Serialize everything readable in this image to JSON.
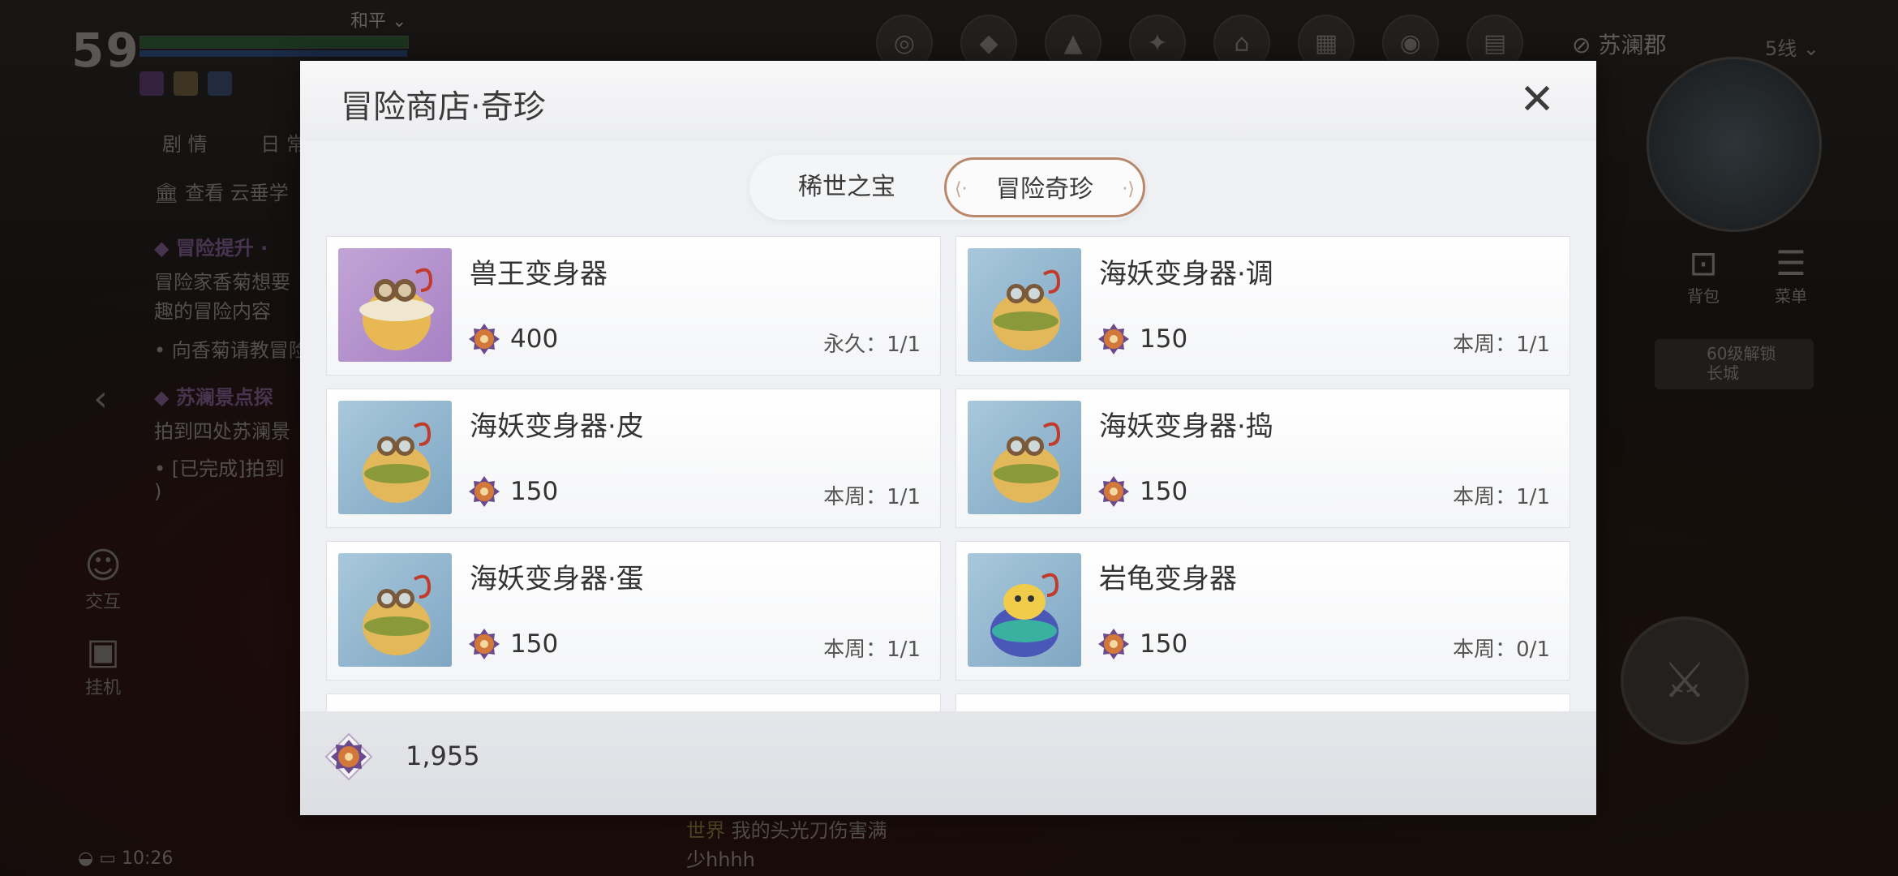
{
  "hud": {
    "level": "59",
    "peace_mode": "和平",
    "tabs": [
      "剧 情",
      "日 常"
    ],
    "quests": [
      {
        "text": "查看 云垂学",
        "kind": "link"
      },
      {
        "text": "冒险提升 ·",
        "kind": "title"
      },
      {
        "text": "冒险家香菊想要",
        "kind": "body"
      },
      {
        "text": "趣的冒险内容",
        "kind": "body"
      },
      {
        "text": "• 向香菊请教冒险",
        "kind": "body"
      },
      {
        "text": "苏澜景点探",
        "kind": "title"
      },
      {
        "text": "拍到四处苏澜景",
        "kind": "body"
      },
      {
        "text": "• [已完成]拍到",
        "kind": "body"
      },
      {
        "text": ")",
        "kind": "body"
      }
    ],
    "left_buttons": {
      "interact": "交互",
      "auto": "挂机"
    },
    "region": "苏澜郡",
    "line": "5线",
    "right_labels": {
      "bag": "背包",
      "menu": "菜单"
    },
    "unlock_notice": "60级解锁\n长城",
    "clock": "10:26",
    "chat": {
      "channel": "世界",
      "message": "我的头光刀伤害满",
      "message2": "少hhhh"
    }
  },
  "shop": {
    "title": "冒险商店·奇珍",
    "tabs": [
      {
        "label": "稀世之宝",
        "active": false
      },
      {
        "label": "冒险奇珍",
        "active": true
      }
    ],
    "items": [
      {
        "name": "兽王变身器",
        "price": "400",
        "limit": "永久：1/1",
        "thumb": "purple"
      },
      {
        "name": "海妖变身器·调",
        "price": "150",
        "limit": "本周：1/1",
        "thumb": "blue"
      },
      {
        "name": "海妖变身器·皮",
        "price": "150",
        "limit": "本周：1/1",
        "thumb": "blue"
      },
      {
        "name": "海妖变身器·捣",
        "price": "150",
        "limit": "本周：1/1",
        "thumb": "blue"
      },
      {
        "name": "海妖变身器·蛋",
        "price": "150",
        "limit": "本周：1/1",
        "thumb": "blue"
      },
      {
        "name": "岩龟变身器",
        "price": "150",
        "limit": "本周：0/1",
        "thumb": "blue-rock"
      }
    ],
    "currency_amount": "1,955"
  },
  "colors": {
    "accent_tab_border": "#b9876c",
    "coin_orange": "#d2783a",
    "coin_purple": "#6a4a8c"
  }
}
